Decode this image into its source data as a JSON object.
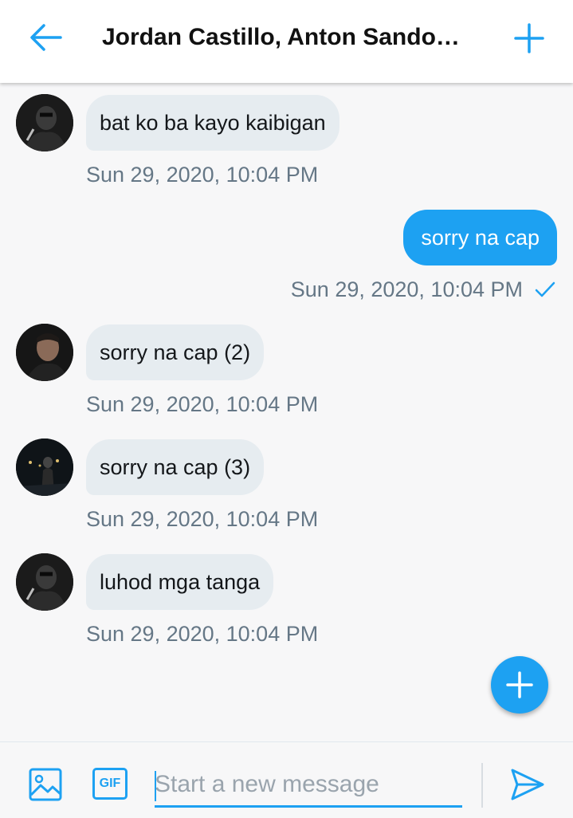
{
  "header": {
    "title": "Jordan Castillo, Anton Sandov…",
    "back_icon": "arrow-left-icon",
    "add_icon": "plus-icon"
  },
  "colors": {
    "accent": "#1da1f2",
    "incoming_bubble": "#e6ecf0",
    "timestamp": "#657786"
  },
  "messages": [
    {
      "direction": "incoming",
      "text": "bat ko ba kayo kaibigan",
      "time": "Sun 29, 2020, 10:04 PM"
    },
    {
      "direction": "outgoing",
      "text": "sorry na cap",
      "time": "Sun 29, 2020, 10:04 PM",
      "status_icon": "check-icon"
    },
    {
      "direction": "incoming",
      "text": "sorry na cap (2)",
      "time": "Sun 29, 2020, 10:04 PM"
    },
    {
      "direction": "incoming",
      "text": "sorry na cap (3)",
      "time": "Sun 29, 2020, 10:04 PM"
    },
    {
      "direction": "incoming",
      "text": "luhod mga tanga",
      "time": "Sun 29, 2020, 10:04 PM"
    }
  ],
  "compose": {
    "placeholder": "Start a new message",
    "gif_label": "GIF",
    "image_icon": "image-icon",
    "send_icon": "send-icon"
  },
  "fab": {
    "icon": "plus-icon"
  }
}
